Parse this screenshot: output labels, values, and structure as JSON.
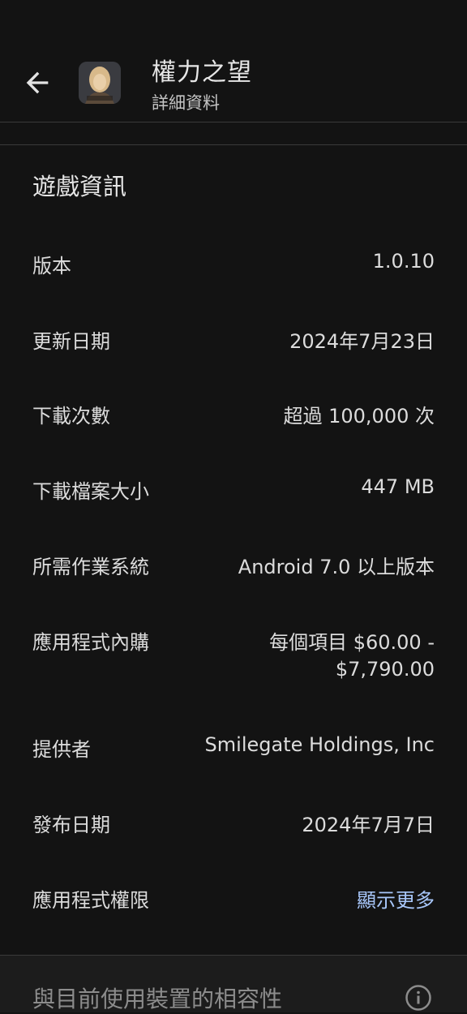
{
  "header": {
    "title": "權力之望",
    "subtitle": "詳細資料",
    "icon": "game-avatar"
  },
  "section": {
    "title": "遊戲資訊",
    "rows": [
      {
        "label": "版本",
        "value": "1.0.10"
      },
      {
        "label": "更新日期",
        "value": "2024年7月23日"
      },
      {
        "label": "下載次數",
        "value": "超過 100,000 次"
      },
      {
        "label": "下載檔案大小",
        "value": "447 MB"
      },
      {
        "label": "所需作業系統",
        "value": "Android 7.0 以上版本"
      },
      {
        "label": "應用程式內購",
        "value_line1": "每個項目 $60.00 -",
        "value_line2": "$7,790.00"
      },
      {
        "label": "提供者",
        "value": "Smilegate Holdings, Inc"
      },
      {
        "label": "發布日期",
        "value": "2024年7月7日"
      },
      {
        "label": "應用程式權限",
        "value": "顯示更多"
      }
    ]
  },
  "compat": {
    "title": "與目前使用裝置的相容性",
    "icon": "info-icon"
  },
  "colors": {
    "background": "#131313",
    "link": "#a8c7fa",
    "text": "#dcdcdc"
  }
}
